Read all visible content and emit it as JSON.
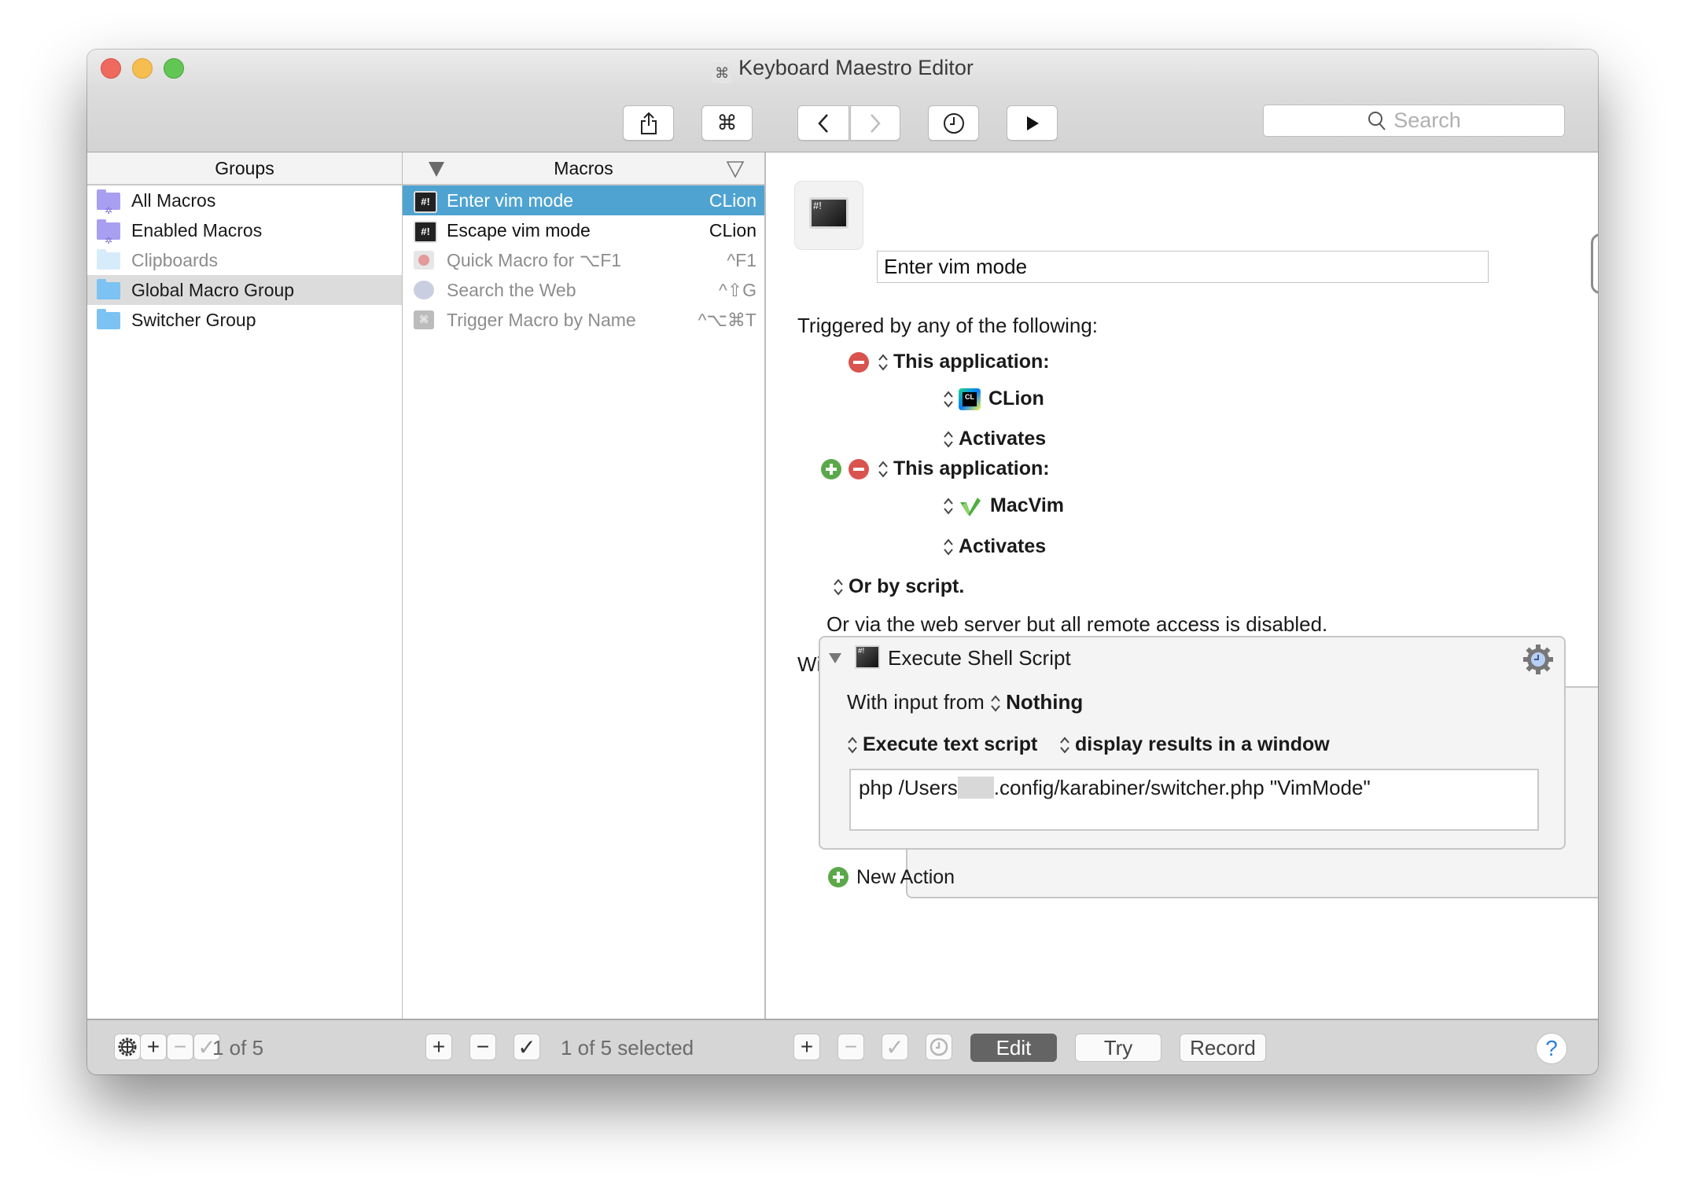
{
  "window": {
    "title": "Keyboard Maestro Editor",
    "title_icon": "⌘"
  },
  "toolbar": {
    "share_icon": "share-icon",
    "command_label": "⌘",
    "back_icon": "chevron-left-icon",
    "forward_icon": "chevron-right-icon",
    "history_icon": "clock-icon",
    "run_icon": "play-icon",
    "search_placeholder": "Search"
  },
  "groups": {
    "header": "Groups",
    "items": [
      {
        "label": "All Macros",
        "icon": "smart-folder-icon",
        "state": "normal"
      },
      {
        "label": "Enabled Macros",
        "icon": "smart-folder-icon",
        "state": "normal"
      },
      {
        "label": "Clipboards",
        "icon": "folder-icon",
        "state": "disabled"
      },
      {
        "label": "Global Macro Group",
        "icon": "folder-icon",
        "state": "selected"
      },
      {
        "label": "Switcher Group",
        "icon": "folder-icon",
        "state": "normal"
      }
    ]
  },
  "macros": {
    "header": "Macros",
    "items": [
      {
        "label": "Enter vim mode",
        "trigger": "CLion",
        "icon": "shell-script-icon",
        "state": "selected"
      },
      {
        "label": "Escape vim mode",
        "trigger": "CLion",
        "icon": "shell-script-icon",
        "state": "normal"
      },
      {
        "label": "Quick Macro for ⌥F1",
        "trigger": "^F1",
        "icon": "record-key-icon",
        "state": "disabled"
      },
      {
        "label": "Search the Web",
        "trigger": "^⇧G",
        "icon": "globe-icon",
        "state": "disabled"
      },
      {
        "label": "Trigger Macro by Name",
        "trigger": "^⌥⌘T",
        "icon": "command-key-icon",
        "state": "disabled"
      }
    ]
  },
  "detail": {
    "macro_name": "Enter vim mode",
    "enabled": true,
    "triggered_by": "Triggered by any of the following:",
    "triggers": [
      {
        "type_label": "This application:",
        "app": "CLion",
        "event": "Activates"
      },
      {
        "type_label": "This application:",
        "app": "MacVim",
        "event": "Activates"
      }
    ],
    "or_by_script": "Or by script.",
    "web_server_note": "Or via the web server but all remote access is disabled.",
    "will_execute": "Will execute the following actions:",
    "action": {
      "title": "Execute Shell Script",
      "input_label": "With input from",
      "input_value": "Nothing",
      "mode": "Execute text script",
      "output": "display results in a window",
      "script_prefix": "php /Users",
      "script_suffix": ".config/karabiner/switcher.php \"VimMode\""
    },
    "new_action": "New Action"
  },
  "bottombar": {
    "groups_count": "1 of 5",
    "macros_count": "1 of 5 selected",
    "edit_label": "Edit",
    "try_label": "Try",
    "record_label": "Record",
    "help_label": "?"
  },
  "colors": {
    "selection_blue": "#4fa3d1",
    "selected_group_bg": "#dcdcdc",
    "remove_red": "#d9534f",
    "add_green": "#5ba84a",
    "help_blue": "#2f7de1"
  }
}
